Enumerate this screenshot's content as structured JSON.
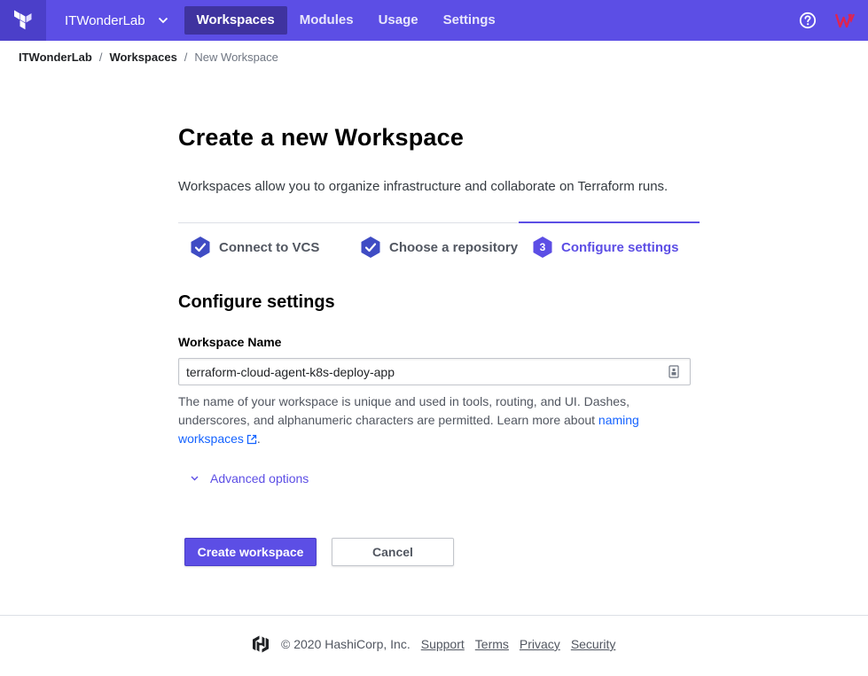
{
  "nav": {
    "org_name": "ITWonderLab",
    "tabs": [
      {
        "label": "Workspaces",
        "active": true
      },
      {
        "label": "Modules",
        "active": false
      },
      {
        "label": "Usage",
        "active": false
      },
      {
        "label": "Settings",
        "active": false
      }
    ],
    "brand_color": "#5c4ee5",
    "icons": {
      "logo": "terraform-logo-icon",
      "org_dropdown": "chevron-down-icon",
      "help": "help-circle-icon",
      "avatar": "user-avatar-icon"
    }
  },
  "breadcrumb": {
    "items": [
      "ITWonderLab",
      "Workspaces",
      "New Workspace"
    ],
    "separator": "/"
  },
  "page": {
    "title": "Create a new Workspace",
    "intro": "Workspaces allow you to organize infrastructure and collaborate on Terraform runs."
  },
  "steps": [
    {
      "label": "Connect to VCS",
      "status": "complete",
      "icon": "check-hexagon-icon"
    },
    {
      "label": "Choose a repository",
      "status": "complete",
      "icon": "check-hexagon-icon"
    },
    {
      "number": "3",
      "label": "Configure settings",
      "status": "active",
      "icon": "number-hexagon-icon"
    }
  ],
  "form": {
    "section_title": "Configure settings",
    "workspace_name_label": "Workspace Name",
    "workspace_name_value": "terraform-cloud-agent-k8s-deploy-app",
    "help_text_before_link": "The name of your workspace is unique and used in tools, routing, and UI. Dashes, underscores, and alphanumeric characters are permitted. Learn more about ",
    "help_link_text": "naming workspaces",
    "help_text_after_link": ".",
    "advanced_options_label": "Advanced options",
    "create_button_label": "Create workspace",
    "cancel_button_label": "Cancel"
  },
  "footer": {
    "copyright": "© 2020 HashiCorp, Inc.",
    "links": [
      "Support",
      "Terms",
      "Privacy",
      "Security"
    ],
    "icon": "hashicorp-logo-icon"
  }
}
